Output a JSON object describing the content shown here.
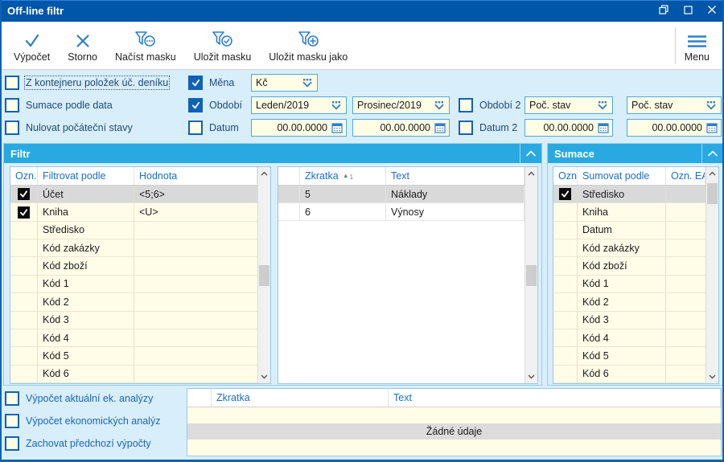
{
  "window": {
    "title": "Off-line filtr",
    "controls": {
      "restore": "restore",
      "maximize": "maximize",
      "close": "close"
    }
  },
  "toolbar": {
    "buttons": [
      {
        "label": "Výpočet",
        "icon": "check-icon"
      },
      {
        "label": "Storno",
        "icon": "cancel-x-icon"
      },
      {
        "label": "Načíst masku",
        "icon": "mask-load-icon"
      },
      {
        "label": "Uložit masku",
        "icon": "mask-save-icon"
      },
      {
        "label": "Uložit masku jako",
        "icon": "mask-save-as-icon"
      }
    ],
    "menu_label": "Menu"
  },
  "options": {
    "left_checkboxes": [
      {
        "label": "Z kontejneru položek úč. deníku",
        "checked": false,
        "focused": true
      },
      {
        "label": "Sumace podle data",
        "checked": false
      },
      {
        "label": "Nulovat počáteční stavy",
        "checked": false
      }
    ],
    "mena": {
      "label": "Měna",
      "checked": true,
      "value": "Kč"
    },
    "obdobi": {
      "label": "Období",
      "checked": true,
      "from": "Leden/2019",
      "to": "Prosinec/2019"
    },
    "datum": {
      "label": "Datum",
      "checked": false,
      "from": "00.00.0000",
      "to": "00.00.0000"
    },
    "obdobi2": {
      "label": "Období 2",
      "checked": false,
      "from": "Poč. stav",
      "to": "Poč. stav"
    },
    "datum2": {
      "label": "Datum 2",
      "checked": false,
      "from": "00.00.0000",
      "to": "00.00.0000"
    }
  },
  "filtr": {
    "title": "Filtr",
    "table": {
      "columns": [
        "Ozn.",
        "Filtrovat podle",
        "Hodnota"
      ],
      "rows": [
        {
          "checked": true,
          "name": "Účet",
          "value": "<5;6>",
          "selected": true
        },
        {
          "checked": true,
          "name": "Kniha",
          "value": "<U>"
        },
        {
          "checked": false,
          "name": "Středisko",
          "value": ""
        },
        {
          "checked": false,
          "name": "Kód zakázky",
          "value": ""
        },
        {
          "checked": false,
          "name": "Kód zboží",
          "value": ""
        },
        {
          "checked": false,
          "name": "Kód 1",
          "value": ""
        },
        {
          "checked": false,
          "name": "Kód 2",
          "value": ""
        },
        {
          "checked": false,
          "name": "Kód 3",
          "value": ""
        },
        {
          "checked": false,
          "name": "Kód 4",
          "value": ""
        },
        {
          "checked": false,
          "name": "Kód 5",
          "value": ""
        },
        {
          "checked": false,
          "name": "Kód 6",
          "value": ""
        }
      ]
    },
    "detail": {
      "columns": [
        "",
        "Zkratka",
        "Text"
      ],
      "sort": {
        "column": "Zkratka",
        "direction": "asc",
        "order": "1"
      },
      "rows": [
        {
          "zkratka": "5",
          "text": "Náklady",
          "selected": true
        },
        {
          "zkratka": "6",
          "text": "Výnosy"
        }
      ]
    }
  },
  "sumace": {
    "title": "Sumace",
    "table": {
      "columns": [
        "Ozn.",
        "Sumovat podle",
        "Ozn. EA"
      ],
      "rows": [
        {
          "checked": true,
          "name": "Středisko",
          "value": "",
          "selected": true
        },
        {
          "checked": false,
          "name": "Kniha",
          "value": ""
        },
        {
          "checked": false,
          "name": "Datum",
          "value": ""
        },
        {
          "checked": false,
          "name": "Kód zakázky",
          "value": ""
        },
        {
          "checked": false,
          "name": "Kód zboží",
          "value": ""
        },
        {
          "checked": false,
          "name": "Kód 1",
          "value": ""
        },
        {
          "checked": false,
          "name": "Kód 2",
          "value": ""
        },
        {
          "checked": false,
          "name": "Kód 3",
          "value": ""
        },
        {
          "checked": false,
          "name": "Kód 4",
          "value": ""
        },
        {
          "checked": false,
          "name": "Kód 5",
          "value": ""
        },
        {
          "checked": false,
          "name": "Kód 6",
          "value": ""
        }
      ]
    }
  },
  "bottom": {
    "checkboxes": [
      {
        "label": "Výpočet aktuální ek. analýzy",
        "checked": false
      },
      {
        "label": "Výpočet ekonomických analýz",
        "checked": false
      },
      {
        "label": "Zachovat předchozí výpočty",
        "checked": false
      }
    ],
    "table": {
      "columns": [
        "",
        "Zkratka",
        "Text"
      ],
      "empty_text": "Žádné údaje"
    }
  },
  "colors": {
    "titlebar": "#0056a8",
    "panel_header": "#29a9e2",
    "dialog_bg": "#d9eefb",
    "field_bg": "#fffde5",
    "field_border": "#47abe3",
    "row_bg": "#fffde8",
    "selected_row": "#d9d9d9",
    "icon_blue": "#2e7ed3",
    "header_text": "#1a6fc5",
    "checkbox_blue": "#1062b4"
  }
}
